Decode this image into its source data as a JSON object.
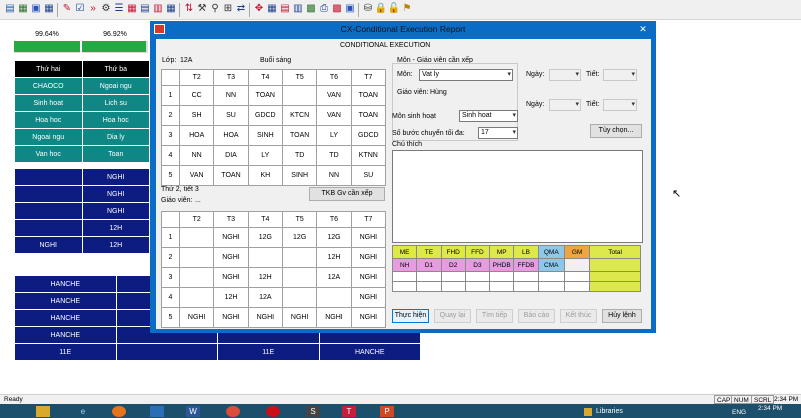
{
  "toolbar": {
    "icons": [
      {
        "name": "app-icon",
        "glyph": "▤",
        "color": "#1e5aa8"
      },
      {
        "name": "grid-icon",
        "glyph": "▦",
        "color": "#2a6e2a"
      },
      {
        "name": "chart-icon",
        "glyph": "▣",
        "color": "#2a52be"
      },
      {
        "name": "table-icon",
        "glyph": "▦",
        "color": "#1b3c8c"
      },
      {
        "name": "edit-icon",
        "glyph": "✎",
        "color": "#c8102e"
      },
      {
        "name": "check-icon",
        "glyph": "☑",
        "color": "#1b3c8c"
      },
      {
        "name": "forward-icon",
        "glyph": "»",
        "color": "#c8102e"
      },
      {
        "name": "settings-icon",
        "glyph": "⚙",
        "color": "#333"
      },
      {
        "name": "list-icon",
        "glyph": "☰",
        "color": "#1b3c8c"
      },
      {
        "name": "calendar-icon",
        "glyph": "▦",
        "color": "#c8102e"
      },
      {
        "name": "document-icon",
        "glyph": "▤",
        "color": "#1b3c8c"
      },
      {
        "name": "report-icon",
        "glyph": "▥",
        "color": "#c8102e"
      },
      {
        "name": "table-edit-icon",
        "glyph": "▦",
        "color": "#1b3c8c"
      },
      {
        "name": "sort-icon",
        "glyph": "⇅",
        "color": "#c8102e"
      },
      {
        "name": "tools-icon",
        "glyph": "⚒",
        "color": "#333"
      },
      {
        "name": "filter-icon",
        "glyph": "⚲",
        "color": "#333"
      },
      {
        "name": "tree-icon",
        "glyph": "⊞",
        "color": "#333"
      },
      {
        "name": "swap-icon",
        "glyph": "⇄",
        "color": "#1b3c8c"
      },
      {
        "name": "move-icon",
        "glyph": "✥",
        "color": "#c8102e"
      },
      {
        "name": "grid-view-icon",
        "glyph": "▦",
        "color": "#1b3c8c"
      },
      {
        "name": "layout-icon",
        "glyph": "▤",
        "color": "#c8102e"
      },
      {
        "name": "export-icon",
        "glyph": "▥",
        "color": "#1b3c8c"
      },
      {
        "name": "color-icon",
        "glyph": "▩",
        "color": "#2a6e2a"
      },
      {
        "name": "print-icon",
        "glyph": "⎙",
        "color": "#1b3c8c"
      },
      {
        "name": "palette-icon",
        "glyph": "▩",
        "color": "#c8102e"
      },
      {
        "name": "view-icon",
        "glyph": "▣",
        "color": "#2a52be"
      },
      {
        "name": "database-icon",
        "glyph": "⛁",
        "color": "#333"
      },
      {
        "name": "lock-icon",
        "glyph": "🔒",
        "color": "#b8860b"
      },
      {
        "name": "unlock-icon",
        "glyph": "🔓",
        "color": "#b8860b"
      },
      {
        "name": "help-icon",
        "glyph": "⚑",
        "color": "#b8860b"
      }
    ]
  },
  "progress": [
    {
      "label": "99.64%",
      "value": 0.9964
    },
    {
      "label": "96.92%",
      "value": 0.9692
    }
  ],
  "bg_table1": {
    "headers": [
      "Thứ hai",
      "Thứ ba"
    ],
    "rows": [
      [
        "CHAOCO",
        "Ngoai ngu"
      ],
      [
        "Sinh hoat",
        "Lich su"
      ],
      [
        "Hoa hoc",
        "Hoa hoc"
      ],
      [
        "Ngoai ngu",
        "Dia ly"
      ],
      [
        "Van hoc",
        "Toan"
      ]
    ]
  },
  "bg_table2": {
    "rows": [
      [
        "",
        "NGHI"
      ],
      [
        "",
        "NGHI"
      ],
      [
        "",
        "NGHI"
      ],
      [
        "",
        "12H"
      ],
      [
        "NGHI",
        "12H"
      ]
    ]
  },
  "bg_table3": {
    "rows": [
      [
        "HANCHE",
        "",
        "",
        ""
      ],
      [
        "HANCHE",
        "",
        "",
        ""
      ],
      [
        "HANCHE",
        "",
        "",
        ""
      ],
      [
        "HANCHE",
        "",
        "",
        ""
      ],
      [
        "11E",
        "",
        "11E",
        "HANCHE"
      ]
    ]
  },
  "dialog": {
    "title": "CX-Conditional Execution Report",
    "subtitle": "CONDITIONAL EXECUTION",
    "class_label": "Lớp:",
    "class_value": "12A",
    "session": "Buổi sáng",
    "days": [
      "T2",
      "T3",
      "T4",
      "T5",
      "T6",
      "T7"
    ],
    "schedule": [
      [
        "1",
        "CC",
        "NN",
        "TOAN",
        "",
        "VAN",
        "TOAN"
      ],
      [
        "2",
        "SH",
        "SU",
        "GDCD",
        "KTCN",
        "VAN",
        "TOAN"
      ],
      [
        "3",
        "HOA",
        "HOA",
        "SINH",
        "TOAN",
        "LY",
        "GDCD"
      ],
      [
        "4",
        "NN",
        "DIA",
        "LY",
        "TD",
        "TD",
        "KTNN"
      ],
      [
        "5",
        "VAN",
        "TOAN",
        "KH",
        "SINH",
        "NN",
        "SU"
      ]
    ],
    "slot_info": "Thứ 2, tiết 3",
    "teacher_label": "Giáo viên:",
    "teacher_value": "...",
    "tkb_button": "TKB Gv cần xếp",
    "teacher_schedule": [
      [
        "1",
        "",
        "NGHI",
        "12G",
        "12G",
        "12G",
        "NGHI"
      ],
      [
        "2",
        "",
        "NGHI",
        "",
        "",
        "12H",
        "NGHI"
      ],
      [
        "3",
        "",
        "NGHI",
        "12H",
        "",
        "12A",
        "NGHI"
      ],
      [
        "4",
        "",
        "12H",
        "12A",
        "",
        "",
        "NGHI"
      ],
      [
        "5",
        "NGHI",
        "NGHI",
        "NGHI",
        "NGHI",
        "NGHI",
        "NGHI"
      ]
    ],
    "subject_group_title": "Môn - Giáo viên cần xếp",
    "subject_label": "Môn:",
    "subject_value": "Vat ly",
    "teacher2_label": "Giáo viên:",
    "teacher2_value": "Hùng",
    "day_label": "Ngày:",
    "period_label": "Tiết:",
    "activity_label": "Môn sinh hoạt",
    "activity_value": "Sinh hoat",
    "max_steps_label": "Số bước chuyển tối đa:",
    "max_steps_value": "17",
    "options_button": "Tùy chọn...",
    "notes_label": "Chú thích",
    "legend_row1": [
      {
        "t": "ME",
        "c": "#dde84a"
      },
      {
        "t": "TE",
        "c": "#dde84a"
      },
      {
        "t": "FHD",
        "c": "#dde84a"
      },
      {
        "t": "FFD",
        "c": "#dde84a"
      },
      {
        "t": "MP",
        "c": "#dde84a"
      },
      {
        "t": "LB",
        "c": "#dde84a"
      },
      {
        "t": "QMA",
        "c": "#8fc7e8"
      },
      {
        "t": "GM",
        "c": "#f0a640"
      },
      {
        "t": "Total",
        "c": "#dde84a"
      }
    ],
    "legend_row2": [
      {
        "t": "NH",
        "c": "#e79be0"
      },
      {
        "t": "D1",
        "c": "#e79be0"
      },
      {
        "t": "D2",
        "c": "#e79be0"
      },
      {
        "t": "D3",
        "c": "#e79be0"
      },
      {
        "t": "PHDB",
        "c": "#e79be0"
      },
      {
        "t": "FFDB",
        "c": "#e79be0"
      },
      {
        "t": "CMA",
        "c": "#8fc7e8"
      }
    ],
    "buttons": {
      "run": "Thực hiện",
      "back": "Quay lại",
      "next": "Tìm tiếp",
      "report": "Báo cáo",
      "finish": "Kết thúc",
      "cancel": "Hủy lệnh"
    }
  },
  "status": {
    "text": "Ready",
    "caps": "CAP",
    "num": "NUM",
    "scrl": "SCRL",
    "time": "2:34 PM"
  },
  "taskbar": {
    "libraries": "Libraries",
    "lang": "ENG",
    "time": "2:34 PM"
  }
}
